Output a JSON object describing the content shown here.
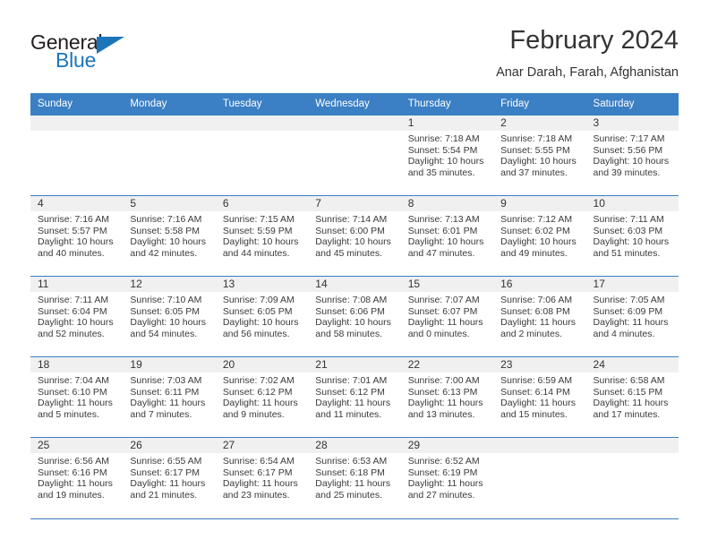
{
  "logo": {
    "primary_text": "General",
    "secondary_text": "Blue",
    "accent_color": "#1b75bb",
    "triangle_icon": "triangle-icon"
  },
  "header": {
    "title": "February 2024",
    "subtitle": "Anar Darah, Farah, Afghanistan"
  },
  "theme": {
    "header_bg": "#3b7fc4",
    "daynum_bg": "#f0f0f0",
    "text": "#333333"
  },
  "labels": {
    "sunrise_prefix": "Sunrise:",
    "sunset_prefix": "Sunset:",
    "daylight_prefix": "Daylight:"
  },
  "weekday_headers": [
    "Sunday",
    "Monday",
    "Tuesday",
    "Wednesday",
    "Thursday",
    "Friday",
    "Saturday"
  ],
  "weeks": [
    [
      {
        "day": "",
        "sunrise": "",
        "sunset": "",
        "daylight_line1": "",
        "daylight_line2": "",
        "empty": true
      },
      {
        "day": "",
        "sunrise": "",
        "sunset": "",
        "daylight_line1": "",
        "daylight_line2": "",
        "empty": true
      },
      {
        "day": "",
        "sunrise": "",
        "sunset": "",
        "daylight_line1": "",
        "daylight_line2": "",
        "empty": true
      },
      {
        "day": "",
        "sunrise": "",
        "sunset": "",
        "daylight_line1": "",
        "daylight_line2": "",
        "empty": true
      },
      {
        "day": "1",
        "sunrise": "Sunrise: 7:18 AM",
        "sunset": "Sunset: 5:54 PM",
        "daylight_line1": "Daylight: 10 hours",
        "daylight_line2": "and 35 minutes."
      },
      {
        "day": "2",
        "sunrise": "Sunrise: 7:18 AM",
        "sunset": "Sunset: 5:55 PM",
        "daylight_line1": "Daylight: 10 hours",
        "daylight_line2": "and 37 minutes."
      },
      {
        "day": "3",
        "sunrise": "Sunrise: 7:17 AM",
        "sunset": "Sunset: 5:56 PM",
        "daylight_line1": "Daylight: 10 hours",
        "daylight_line2": "and 39 minutes."
      }
    ],
    [
      {
        "day": "4",
        "sunrise": "Sunrise: 7:16 AM",
        "sunset": "Sunset: 5:57 PM",
        "daylight_line1": "Daylight: 10 hours",
        "daylight_line2": "and 40 minutes."
      },
      {
        "day": "5",
        "sunrise": "Sunrise: 7:16 AM",
        "sunset": "Sunset: 5:58 PM",
        "daylight_line1": "Daylight: 10 hours",
        "daylight_line2": "and 42 minutes."
      },
      {
        "day": "6",
        "sunrise": "Sunrise: 7:15 AM",
        "sunset": "Sunset: 5:59 PM",
        "daylight_line1": "Daylight: 10 hours",
        "daylight_line2": "and 44 minutes."
      },
      {
        "day": "7",
        "sunrise": "Sunrise: 7:14 AM",
        "sunset": "Sunset: 6:00 PM",
        "daylight_line1": "Daylight: 10 hours",
        "daylight_line2": "and 45 minutes."
      },
      {
        "day": "8",
        "sunrise": "Sunrise: 7:13 AM",
        "sunset": "Sunset: 6:01 PM",
        "daylight_line1": "Daylight: 10 hours",
        "daylight_line2": "and 47 minutes."
      },
      {
        "day": "9",
        "sunrise": "Sunrise: 7:12 AM",
        "sunset": "Sunset: 6:02 PM",
        "daylight_line1": "Daylight: 10 hours",
        "daylight_line2": "and 49 minutes."
      },
      {
        "day": "10",
        "sunrise": "Sunrise: 7:11 AM",
        "sunset": "Sunset: 6:03 PM",
        "daylight_line1": "Daylight: 10 hours",
        "daylight_line2": "and 51 minutes."
      }
    ],
    [
      {
        "day": "11",
        "sunrise": "Sunrise: 7:11 AM",
        "sunset": "Sunset: 6:04 PM",
        "daylight_line1": "Daylight: 10 hours",
        "daylight_line2": "and 52 minutes."
      },
      {
        "day": "12",
        "sunrise": "Sunrise: 7:10 AM",
        "sunset": "Sunset: 6:05 PM",
        "daylight_line1": "Daylight: 10 hours",
        "daylight_line2": "and 54 minutes."
      },
      {
        "day": "13",
        "sunrise": "Sunrise: 7:09 AM",
        "sunset": "Sunset: 6:05 PM",
        "daylight_line1": "Daylight: 10 hours",
        "daylight_line2": "and 56 minutes."
      },
      {
        "day": "14",
        "sunrise": "Sunrise: 7:08 AM",
        "sunset": "Sunset: 6:06 PM",
        "daylight_line1": "Daylight: 10 hours",
        "daylight_line2": "and 58 minutes."
      },
      {
        "day": "15",
        "sunrise": "Sunrise: 7:07 AM",
        "sunset": "Sunset: 6:07 PM",
        "daylight_line1": "Daylight: 11 hours",
        "daylight_line2": "and 0 minutes."
      },
      {
        "day": "16",
        "sunrise": "Sunrise: 7:06 AM",
        "sunset": "Sunset: 6:08 PM",
        "daylight_line1": "Daylight: 11 hours",
        "daylight_line2": "and 2 minutes."
      },
      {
        "day": "17",
        "sunrise": "Sunrise: 7:05 AM",
        "sunset": "Sunset: 6:09 PM",
        "daylight_line1": "Daylight: 11 hours",
        "daylight_line2": "and 4 minutes."
      }
    ],
    [
      {
        "day": "18",
        "sunrise": "Sunrise: 7:04 AM",
        "sunset": "Sunset: 6:10 PM",
        "daylight_line1": "Daylight: 11 hours",
        "daylight_line2": "and 5 minutes."
      },
      {
        "day": "19",
        "sunrise": "Sunrise: 7:03 AM",
        "sunset": "Sunset: 6:11 PM",
        "daylight_line1": "Daylight: 11 hours",
        "daylight_line2": "and 7 minutes."
      },
      {
        "day": "20",
        "sunrise": "Sunrise: 7:02 AM",
        "sunset": "Sunset: 6:12 PM",
        "daylight_line1": "Daylight: 11 hours",
        "daylight_line2": "and 9 minutes."
      },
      {
        "day": "21",
        "sunrise": "Sunrise: 7:01 AM",
        "sunset": "Sunset: 6:12 PM",
        "daylight_line1": "Daylight: 11 hours",
        "daylight_line2": "and 11 minutes."
      },
      {
        "day": "22",
        "sunrise": "Sunrise: 7:00 AM",
        "sunset": "Sunset: 6:13 PM",
        "daylight_line1": "Daylight: 11 hours",
        "daylight_line2": "and 13 minutes."
      },
      {
        "day": "23",
        "sunrise": "Sunrise: 6:59 AM",
        "sunset": "Sunset: 6:14 PM",
        "daylight_line1": "Daylight: 11 hours",
        "daylight_line2": "and 15 minutes."
      },
      {
        "day": "24",
        "sunrise": "Sunrise: 6:58 AM",
        "sunset": "Sunset: 6:15 PM",
        "daylight_line1": "Daylight: 11 hours",
        "daylight_line2": "and 17 minutes."
      }
    ],
    [
      {
        "day": "25",
        "sunrise": "Sunrise: 6:56 AM",
        "sunset": "Sunset: 6:16 PM",
        "daylight_line1": "Daylight: 11 hours",
        "daylight_line2": "and 19 minutes."
      },
      {
        "day": "26",
        "sunrise": "Sunrise: 6:55 AM",
        "sunset": "Sunset: 6:17 PM",
        "daylight_line1": "Daylight: 11 hours",
        "daylight_line2": "and 21 minutes."
      },
      {
        "day": "27",
        "sunrise": "Sunrise: 6:54 AM",
        "sunset": "Sunset: 6:17 PM",
        "daylight_line1": "Daylight: 11 hours",
        "daylight_line2": "and 23 minutes."
      },
      {
        "day": "28",
        "sunrise": "Sunrise: 6:53 AM",
        "sunset": "Sunset: 6:18 PM",
        "daylight_line1": "Daylight: 11 hours",
        "daylight_line2": "and 25 minutes."
      },
      {
        "day": "29",
        "sunrise": "Sunrise: 6:52 AM",
        "sunset": "Sunset: 6:19 PM",
        "daylight_line1": "Daylight: 11 hours",
        "daylight_line2": "and 27 minutes."
      },
      {
        "day": "",
        "sunrise": "",
        "sunset": "",
        "daylight_line1": "",
        "daylight_line2": "",
        "empty": true
      },
      {
        "day": "",
        "sunrise": "",
        "sunset": "",
        "daylight_line1": "",
        "daylight_line2": "",
        "empty": true
      }
    ]
  ]
}
